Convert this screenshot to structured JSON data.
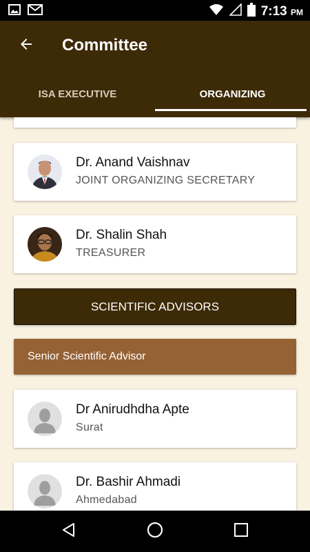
{
  "status_bar": {
    "time": "7:13",
    "ampm": "PM",
    "icons": [
      "image-icon",
      "gmail-icon",
      "wifi-icon",
      "signal-icon",
      "battery-icon"
    ]
  },
  "app_bar": {
    "title": "Committee",
    "back_icon": "arrow-left-icon",
    "color": "#3d2a07"
  },
  "tabs": [
    {
      "label": "ISA EXECUTIVE",
      "active": false
    },
    {
      "label": "ORGANIZING",
      "active": true
    }
  ],
  "members": [
    {
      "name": "Dr. Anand Vaishnav",
      "role": "JOINT ORGANIZING SECRETARY"
    },
    {
      "name": "Dr. Shalin Shah",
      "role": "TREASURER"
    }
  ],
  "section_button": {
    "label": "SCIENTIFIC ADVISORS",
    "color": "#3d2a07"
  },
  "sub_header": {
    "label": "Senior Scientific Advisor",
    "color": "#956235"
  },
  "advisors": [
    {
      "name": "Dr Anirudhdha Apte",
      "location": "Surat"
    },
    {
      "name": "Dr. Bashir Ahmadi",
      "location": "Ahmedabad"
    }
  ],
  "nav_icons": [
    "back-triangle-icon",
    "home-circle-icon",
    "recents-square-icon"
  ]
}
